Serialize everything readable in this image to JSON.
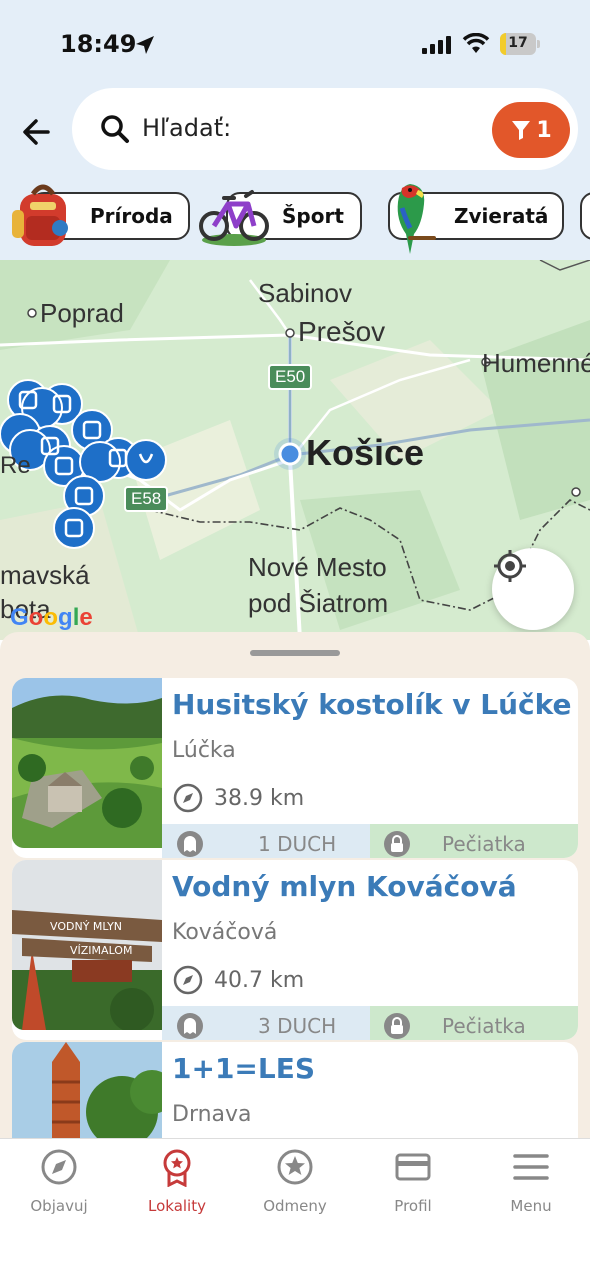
{
  "status_bar": {
    "time": "18:49",
    "battery": "17",
    "battery_fraction": 0.17
  },
  "search": {
    "placeholder": "Hľadať:",
    "filter_count": "1"
  },
  "categories": [
    {
      "label": "Príroda",
      "icon": "backpack-icon"
    },
    {
      "label": "Šport",
      "icon": "bicycle-icon"
    },
    {
      "label": "Zvieratá",
      "icon": "parrot-icon"
    }
  ],
  "map": {
    "cities": [
      "Sabinov",
      "Prešov",
      "Poprad",
      "Humenné",
      "Košice",
      "Nové Mesto",
      "pod Šiatrom",
      "mavská",
      "bota",
      "Re"
    ],
    "roads": [
      "E50",
      "E58"
    ],
    "google_logo": "Google"
  },
  "locations": [
    {
      "title": "Husitský kostolík v Lúčke",
      "place": "Lúčka",
      "distance": "38.9 km",
      "ghosts": "1 DUCH",
      "stamp": "Pečiatka"
    },
    {
      "title": "Vodný mlyn Kováčová",
      "place": "Kováčová",
      "distance": "40.7 km",
      "ghosts": "3 DUCH",
      "stamp": "Pečiatka",
      "sign_line1": "VODNÝ MLYN",
      "sign_line2": "VÍZIMALOM"
    },
    {
      "title": "1+1=LES",
      "place": "Drnava"
    }
  ],
  "nav": [
    {
      "label": "Objavuj",
      "icon": "compass-icon"
    },
    {
      "label": "Lokality",
      "icon": "ribbon-icon"
    },
    {
      "label": "Odmeny",
      "icon": "star-icon"
    },
    {
      "label": "Profil",
      "icon": "card-icon"
    },
    {
      "label": "Menu",
      "icon": "menu-icon"
    }
  ],
  "colors": {
    "accent": "#e2572a",
    "title_blue": "#3b7bb8",
    "active_nav": "#c63a3a",
    "map_pin": "#1e6fc8"
  }
}
